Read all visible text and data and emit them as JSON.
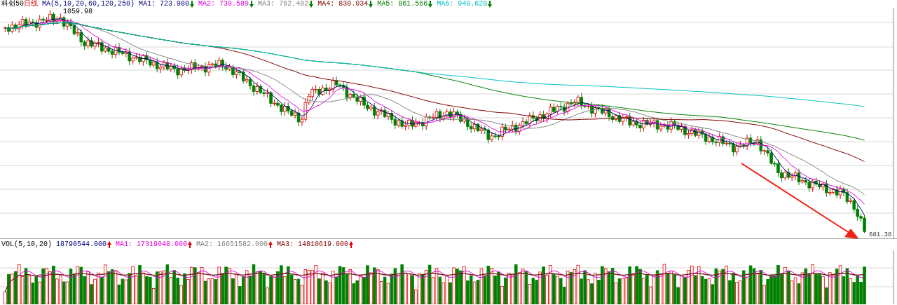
{
  "header": {
    "title": "科创50",
    "period": "日线",
    "ma_params": "MA(5,10,20,60,120,250)",
    "items": [
      {
        "label": "MA1:",
        "value": "723.980",
        "color": "#000080",
        "arrow": {
          "kind": "down",
          "color": "#008000"
        }
      },
      {
        "label": "MA2:",
        "value": "739.589",
        "color": "#e000e0",
        "arrow": {
          "kind": "down",
          "color": "#008000"
        }
      },
      {
        "label": "MA3:",
        "value": "762.402",
        "color": "#808080",
        "arrow": {
          "kind": "down",
          "color": "#008000"
        }
      },
      {
        "label": "MA4:",
        "value": "830.034",
        "color": "#800000",
        "arrow": {
          "kind": "down",
          "color": "#008000"
        }
      },
      {
        "label": "MA5:",
        "value": "861.566",
        "color": "#008000",
        "arrow": {
          "kind": "down",
          "color": "#008000"
        }
      },
      {
        "label": "MA6:",
        "value": "948.620",
        "color": "#00c0c0",
        "arrow": {
          "kind": "down",
          "color": "#008000"
        }
      }
    ]
  },
  "price_chart": {
    "high_label": "1059.98",
    "low_label": "681.38"
  },
  "volume": {
    "title": "VOL(5,10,20)",
    "items": [
      {
        "value": "18790544.000",
        "color": "#000080",
        "arrow": {
          "kind": "up",
          "color": "#e00000"
        }
      },
      {
        "label": "MA1:",
        "value": "17319048.000",
        "color": "#e000e0",
        "arrow": {
          "kind": "up",
          "color": "#e00000"
        }
      },
      {
        "label": "MA2:",
        "value": "16651582.000",
        "color": "#808080",
        "arrow": {
          "kind": "up",
          "color": "#e00000"
        }
      },
      {
        "label": "MA3:",
        "value": "14810619.000",
        "color": "#800000",
        "arrow": {
          "kind": "up",
          "color": "#e00000"
        }
      }
    ]
  }
}
